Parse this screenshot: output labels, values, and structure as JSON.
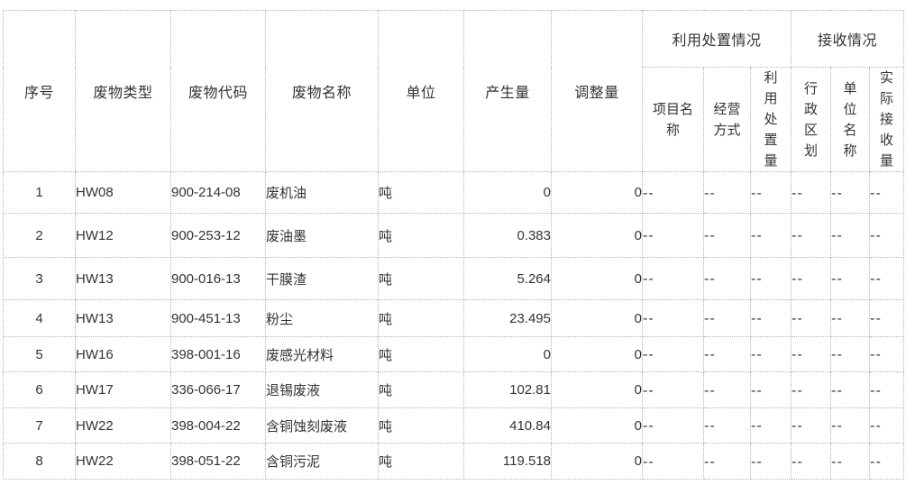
{
  "table": {
    "headers": {
      "index": "序号",
      "waste_type": "废物类型",
      "waste_code": "废物代码",
      "waste_name": "废物名称",
      "unit": "单位",
      "produced": "产生量",
      "adjusted": "调整量",
      "utilization_group": "利用处置情况",
      "project_name": "项目名称",
      "operation_mode": "经营方式",
      "utilization_amount": "利用处置量",
      "receiving_group": "接收情况",
      "admin_region": "行政区划",
      "unit_name": "单位名称",
      "actual_received": "实际接收量"
    },
    "rows": [
      {
        "index": "1",
        "type": "HW08",
        "code": "900-214-08",
        "name": "废机油",
        "unit": "吨",
        "produced": "0",
        "adjusted": "0",
        "project": "--",
        "mode": "--",
        "amount": "--",
        "region": "--",
        "unit_name": "--",
        "received": "--"
      },
      {
        "index": "2",
        "type": "HW12",
        "code": "900-253-12",
        "name": "废油墨",
        "unit": "吨",
        "produced": "0.383",
        "adjusted": "0",
        "project": "--",
        "mode": "--",
        "amount": "--",
        "region": "--",
        "unit_name": "--",
        "received": "--"
      },
      {
        "index": "3",
        "type": "HW13",
        "code": "900-016-13",
        "name": "干膜渣",
        "unit": "吨",
        "produced": "5.264",
        "adjusted": "0",
        "project": "--",
        "mode": "--",
        "amount": "--",
        "region": "--",
        "unit_name": "--",
        "received": "--"
      },
      {
        "index": "4",
        "type": "HW13",
        "code": "900-451-13",
        "name": "粉尘",
        "unit": "吨",
        "produced": "23.495",
        "adjusted": "0",
        "project": "--",
        "mode": "--",
        "amount": "--",
        "region": "--",
        "unit_name": "--",
        "received": "--"
      },
      {
        "index": "5",
        "type": "HW16",
        "code": "398-001-16",
        "name": "废感光材料",
        "unit": "吨",
        "produced": "0",
        "adjusted": "0",
        "project": "--",
        "mode": "--",
        "amount": "--",
        "region": "--",
        "unit_name": "--",
        "received": "--"
      },
      {
        "index": "6",
        "type": "HW17",
        "code": "336-066-17",
        "name": "退锡废液",
        "unit": "吨",
        "produced": "102.81",
        "adjusted": "0",
        "project": "--",
        "mode": "--",
        "amount": "--",
        "region": "--",
        "unit_name": "--",
        "received": "--"
      },
      {
        "index": "7",
        "type": "HW22",
        "code": "398-004-22",
        "name": "含铜蚀刻废液",
        "unit": "吨",
        "produced": "410.84",
        "adjusted": "0",
        "project": "--",
        "mode": "--",
        "amount": "--",
        "region": "--",
        "unit_name": "--",
        "received": "--"
      },
      {
        "index": "8",
        "type": "HW22",
        "code": "398-051-22",
        "name": "含铜污泥",
        "unit": "吨",
        "produced": "119.518",
        "adjusted": "0",
        "project": "--",
        "mode": "--",
        "amount": "--",
        "region": "--",
        "unit_name": "--",
        "received": "--"
      }
    ]
  }
}
